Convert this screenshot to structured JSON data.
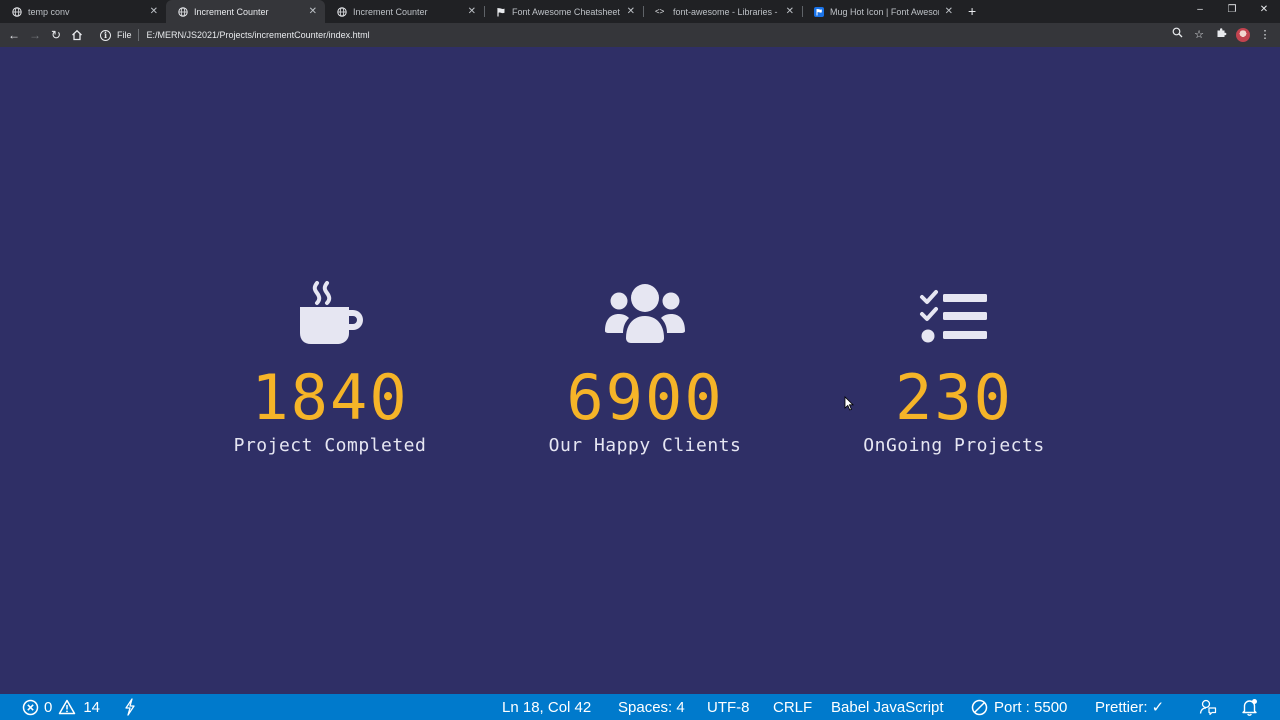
{
  "browser": {
    "tabs": [
      {
        "label": "temp conv",
        "active": false,
        "favicon": "globe-icon"
      },
      {
        "label": "Increment Counter",
        "active": true,
        "favicon": "globe-icon"
      },
      {
        "label": "Increment Counter",
        "active": false,
        "favicon": "globe-icon"
      },
      {
        "label": "Font Awesome Cheatsheet",
        "active": false,
        "favicon": "flag-icon"
      },
      {
        "label": "font-awesome - Libraries - cdnjs",
        "active": false,
        "favicon": "code-icon"
      },
      {
        "label": "Mug Hot Icon | Font Awesome",
        "active": false,
        "favicon": "flag-icon"
      }
    ],
    "address": {
      "scheme_label": "File",
      "url": "E:/MERN/JS2021/Projects/incrementCounter/index.html"
    }
  },
  "counters": [
    {
      "icon": "mug-hot-icon",
      "value": "1840",
      "label": "Project Completed"
    },
    {
      "icon": "users-icon",
      "value": "6900",
      "label": "Our Happy Clients"
    },
    {
      "icon": "tasks-icon",
      "value": "230",
      "label": "OnGoing Projects"
    }
  ],
  "statusbar": {
    "errors": "0",
    "warnings": "14",
    "cursor_position": "Ln 18, Col 42",
    "indentation": "Spaces: 4",
    "encoding": "UTF-8",
    "line_ending": "CRLF",
    "language": "Babel JavaScript",
    "port": "Port : 5500",
    "prettier": "Prettier: ✓"
  },
  "colors": {
    "page_background": "#2f2f66",
    "counter_number": "#f5b428",
    "counter_label": "#e6e6f2",
    "icon": "#e6e6f2",
    "statusbar": "#007acc"
  }
}
